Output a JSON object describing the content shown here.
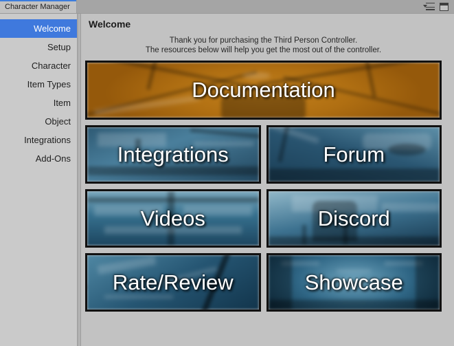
{
  "window": {
    "tab_label": "Character Manager",
    "menu_icon": "hamburger-menu-icon",
    "window_icon": "window-layout-icon",
    "accent_color": "#3c7ddd"
  },
  "sidebar": {
    "items": [
      {
        "label": "Welcome",
        "selected": true
      },
      {
        "label": "Setup",
        "selected": false
      },
      {
        "label": "Character",
        "selected": false
      },
      {
        "label": "Item Types",
        "selected": false
      },
      {
        "label": "Item",
        "selected": false
      },
      {
        "label": "Object",
        "selected": false
      },
      {
        "label": "Integrations",
        "selected": false
      },
      {
        "label": "Add-Ons",
        "selected": false
      }
    ],
    "selection_color": "#3f79dd"
  },
  "content": {
    "title": "Welcome",
    "intro_line_1": "Thank you for purchasing the Third Person Controller.",
    "intro_line_2": "The resources below will help you get the most out of the controller.",
    "hero_tile": {
      "label": "Documentation",
      "accent_color": "#b06f12"
    },
    "tiles": [
      {
        "label": "Integrations",
        "accent_color": "#4a7f9c"
      },
      {
        "label": "Forum",
        "accent_color": "#2a5672"
      },
      {
        "label": "Videos",
        "accent_color": "#356f8d"
      },
      {
        "label": "Discord",
        "accent_color": "#3d7290"
      },
      {
        "label": "Rate/Review",
        "accent_color": "#255572"
      },
      {
        "label": "Showcase",
        "accent_color": "#2f6685"
      }
    ]
  }
}
